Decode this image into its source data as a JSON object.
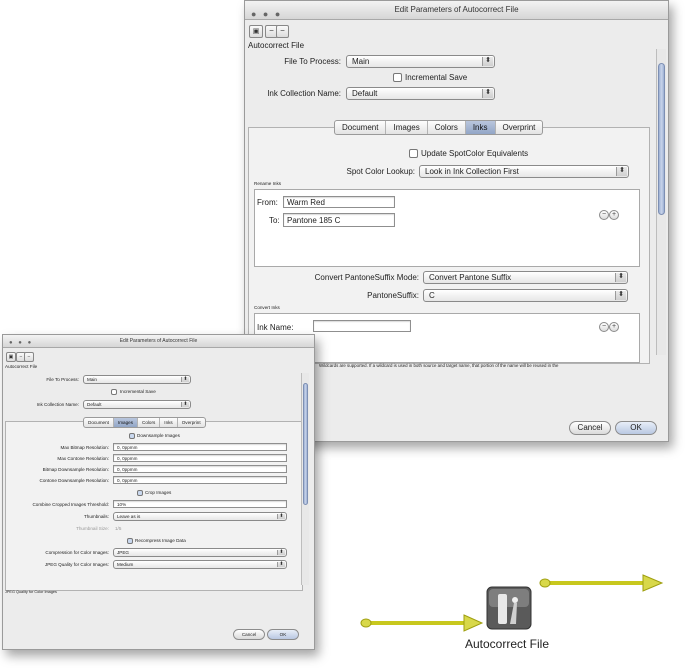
{
  "back_window": {
    "title": "Edit Parameters of Autocorrect File",
    "toolbar_icons": [
      "document-icon",
      "minus-icon",
      "plus-icon"
    ],
    "section": "Autocorrect File",
    "file_to_process_label": "File To Process:",
    "file_to_process_value": "Main",
    "incremental_save_label": "Incremental Save",
    "ink_collection_label": "Ink Collection Name:",
    "ink_collection_value": "Default",
    "tabs": [
      "Document",
      "Images",
      "Colors",
      "Inks",
      "Overprint"
    ],
    "selected_tab": "Inks",
    "update_spot_label": "Update SpotColor Equivalents",
    "spot_lookup_label": "Spot Color Lookup:",
    "spot_lookup_value": "Look in Ink Collection First",
    "rename_group_label": "Rename Inks",
    "from_label": "From:",
    "from_value": "Warm Red",
    "to_label": "To:",
    "to_value": "Pantone 185 C",
    "convert_mode_label": "Convert PantoneSuffix Mode:",
    "convert_mode_value": "Convert Pantone Suffix",
    "pantone_suffix_label": "PantoneSuffix:",
    "pantone_suffix_value": "C",
    "convert_group_label": "Convert Inks",
    "ink_name_label": "Ink Name:",
    "help_text": "Wildcards are supported. If a wildcard is used in both source and target name, that portion of the name will be reused in the",
    "cancel_label": "Cancel",
    "ok_label": "OK"
  },
  "front_window": {
    "title": "Edit Parameters of Autocorrect File",
    "section": "Autocorrect File",
    "file_to_process_label": "File To Process:",
    "file_to_process_value": "Main",
    "incremental_save_label": "Incremental Save",
    "ink_collection_label": "Ink Collection Name:",
    "ink_collection_value": "Default",
    "tabs": [
      "Document",
      "Images",
      "Colors",
      "Inks",
      "Overprint"
    ],
    "selected_tab": "Images",
    "downsample_label": "Downsample Images",
    "max_bitmap_label": "Max Bitmap Resolution:",
    "max_bitmap_value": "0, 0ppmm",
    "max_contone_label": "Max Contone Resolution:",
    "max_contone_value": "0, 0ppmm",
    "bitmap_ds_label": "Bitmap Downsample Resolution:",
    "bitmap_ds_value": "0, 0ppmm",
    "contone_ds_label": "Contone Downsample Resolution:",
    "contone_ds_value": "0, 0ppmm",
    "crop_label": "Crop Images",
    "combine_label": "Combine Cropped Images Threshold:",
    "combine_value": "10%",
    "thumbnails_label": "Thumbnails:",
    "thumbnails_value": "Leave as is",
    "thumbnail_size_label": "Thumbnail Size:",
    "thumbnail_size_value": "1/5",
    "recompress_label": "Recompress Image Data",
    "compression_label": "Compression for Color Images:",
    "compression_value": "JPEG",
    "jpeg_quality_label": "JPEG Quality for Color Images:",
    "jpeg_quality_value": "Medium",
    "status_text": "JPEG Quality for Color Images",
    "cancel_label": "Cancel",
    "ok_label": "OK"
  },
  "workflow": {
    "node_label": "Autocorrect File",
    "icon": "autocorrect-tool-icon",
    "connector_color": "#c8c81e"
  }
}
